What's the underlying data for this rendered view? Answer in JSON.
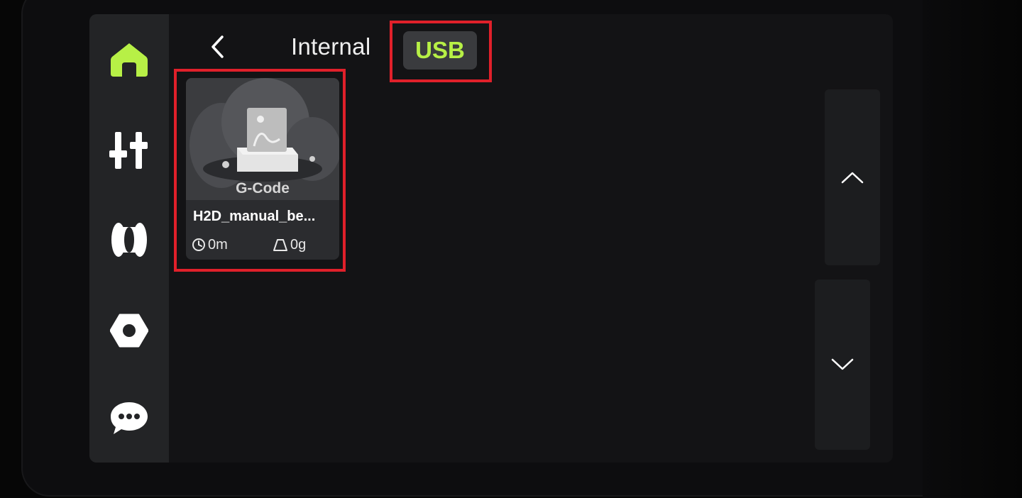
{
  "sidebar": {
    "items": [
      {
        "name": "home",
        "icon": "home-icon",
        "active": true
      },
      {
        "name": "controls",
        "icon": "sliders-icon",
        "active": false
      },
      {
        "name": "filament",
        "icon": "filament-spool-icon",
        "active": false
      },
      {
        "name": "settings",
        "icon": "hex-nut-icon",
        "active": false
      },
      {
        "name": "messages",
        "icon": "chat-bubble-icon",
        "active": false
      }
    ]
  },
  "header": {
    "back_icon": "chevron-left-icon",
    "tabs": [
      {
        "label": "Internal",
        "selected": false
      },
      {
        "label": "USB",
        "selected": true
      }
    ]
  },
  "files": [
    {
      "type_label": "G-Code",
      "name": "H2D_manual_be...",
      "time": "0m",
      "weight": "0g",
      "time_icon": "clock-icon",
      "weight_icon": "weight-icon"
    }
  ],
  "scroll": {
    "up_icon": "chevron-up-icon",
    "down_icon": "chevron-down-icon"
  },
  "colors": {
    "accent": "#b7f046",
    "highlight": "#e0202a",
    "sidebar_bg": "#232426",
    "screen_bg": "#131315"
  }
}
